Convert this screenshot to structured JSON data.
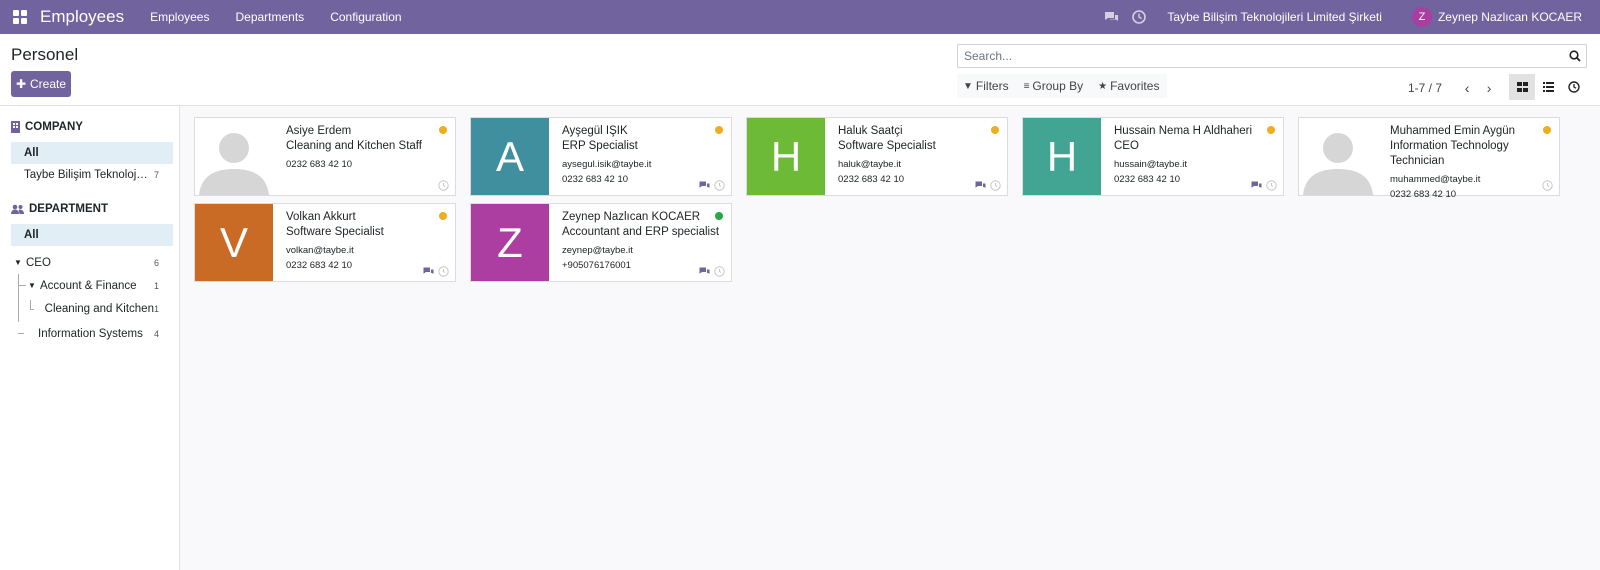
{
  "app": {
    "title": "Employees",
    "menu": [
      "Employees",
      "Departments",
      "Configuration"
    ],
    "company": "Taybe Bilişim Teknolojileri Limited Şirketi",
    "user": {
      "initial": "Z",
      "name": "Zeynep Nazlıcan KOCAER"
    }
  },
  "control": {
    "breadcrumb": "Personel",
    "create_label": "Create",
    "search_placeholder": "Search...",
    "filters_label": "Filters",
    "groupby_label": "Group By",
    "favorites_label": "Favorites",
    "pager": "1-7 / 7"
  },
  "sidebar": {
    "company": {
      "header": "COMPANY",
      "all": "All",
      "items": [
        {
          "label": "Taybe Bilişim Teknolojileri Limited Şirketi",
          "count": "7"
        }
      ]
    },
    "department": {
      "header": "DEPARTMENT",
      "all": "All",
      "items": [
        {
          "label": "CEO",
          "count": "6"
        },
        {
          "label": "Account & Finance",
          "count": "1"
        },
        {
          "label": "Cleaning and Kitchen",
          "count": "1"
        },
        {
          "label": "Information Systems",
          "count": "4"
        }
      ]
    }
  },
  "employees": [
    {
      "name": "Asiye Erdem",
      "job": "Cleaning and Kitchen Staff",
      "email": "",
      "phone": "0232 683 42 10",
      "initial": "",
      "color": "",
      "status_color": "#f0ad1e",
      "chat": false
    },
    {
      "name": "Ayşegül IŞIK",
      "job": "ERP Specialist",
      "email": "aysegul.isik@taybe.it",
      "phone": "0232 683 42 10",
      "initial": "A",
      "color": "#3f8f9f",
      "status_color": "#f0ad1e",
      "chat": true
    },
    {
      "name": "Haluk Saatçi",
      "job": "Software Specialist",
      "email": "haluk@taybe.it",
      "phone": "0232 683 42 10",
      "initial": "H",
      "color": "#6dba37",
      "status_color": "#f0ad1e",
      "chat": true
    },
    {
      "name": "Hussain Nema H Aldhaheri",
      "job": "CEO",
      "email": "hussain@taybe.it",
      "phone": "0232 683 42 10",
      "initial": "H",
      "color": "#42a593",
      "status_color": "#f0ad1e",
      "chat": true
    },
    {
      "name": "Muhammed Emin Aygün",
      "job": "Information Technology Technician",
      "email": "muhammed@taybe.it",
      "phone": "0232 683 42 10",
      "initial": "",
      "color": "",
      "status_color": "#f0ad1e",
      "chat": false
    },
    {
      "name": "Volkan Akkurt",
      "job": "Software Specialist",
      "email": "volkan@taybe.it",
      "phone": "0232 683 42 10",
      "initial": "V",
      "color": "#c96b25",
      "status_color": "#f0ad1e",
      "chat": true
    },
    {
      "name": "Zeynep Nazlıcan KOCAER",
      "job": "Accountant and ERP specialist",
      "email": "zeynep@taybe.it",
      "phone": "+905076176001",
      "initial": "Z",
      "color": "#ab3ea0",
      "status_color": "#28a745",
      "chat": true
    }
  ]
}
